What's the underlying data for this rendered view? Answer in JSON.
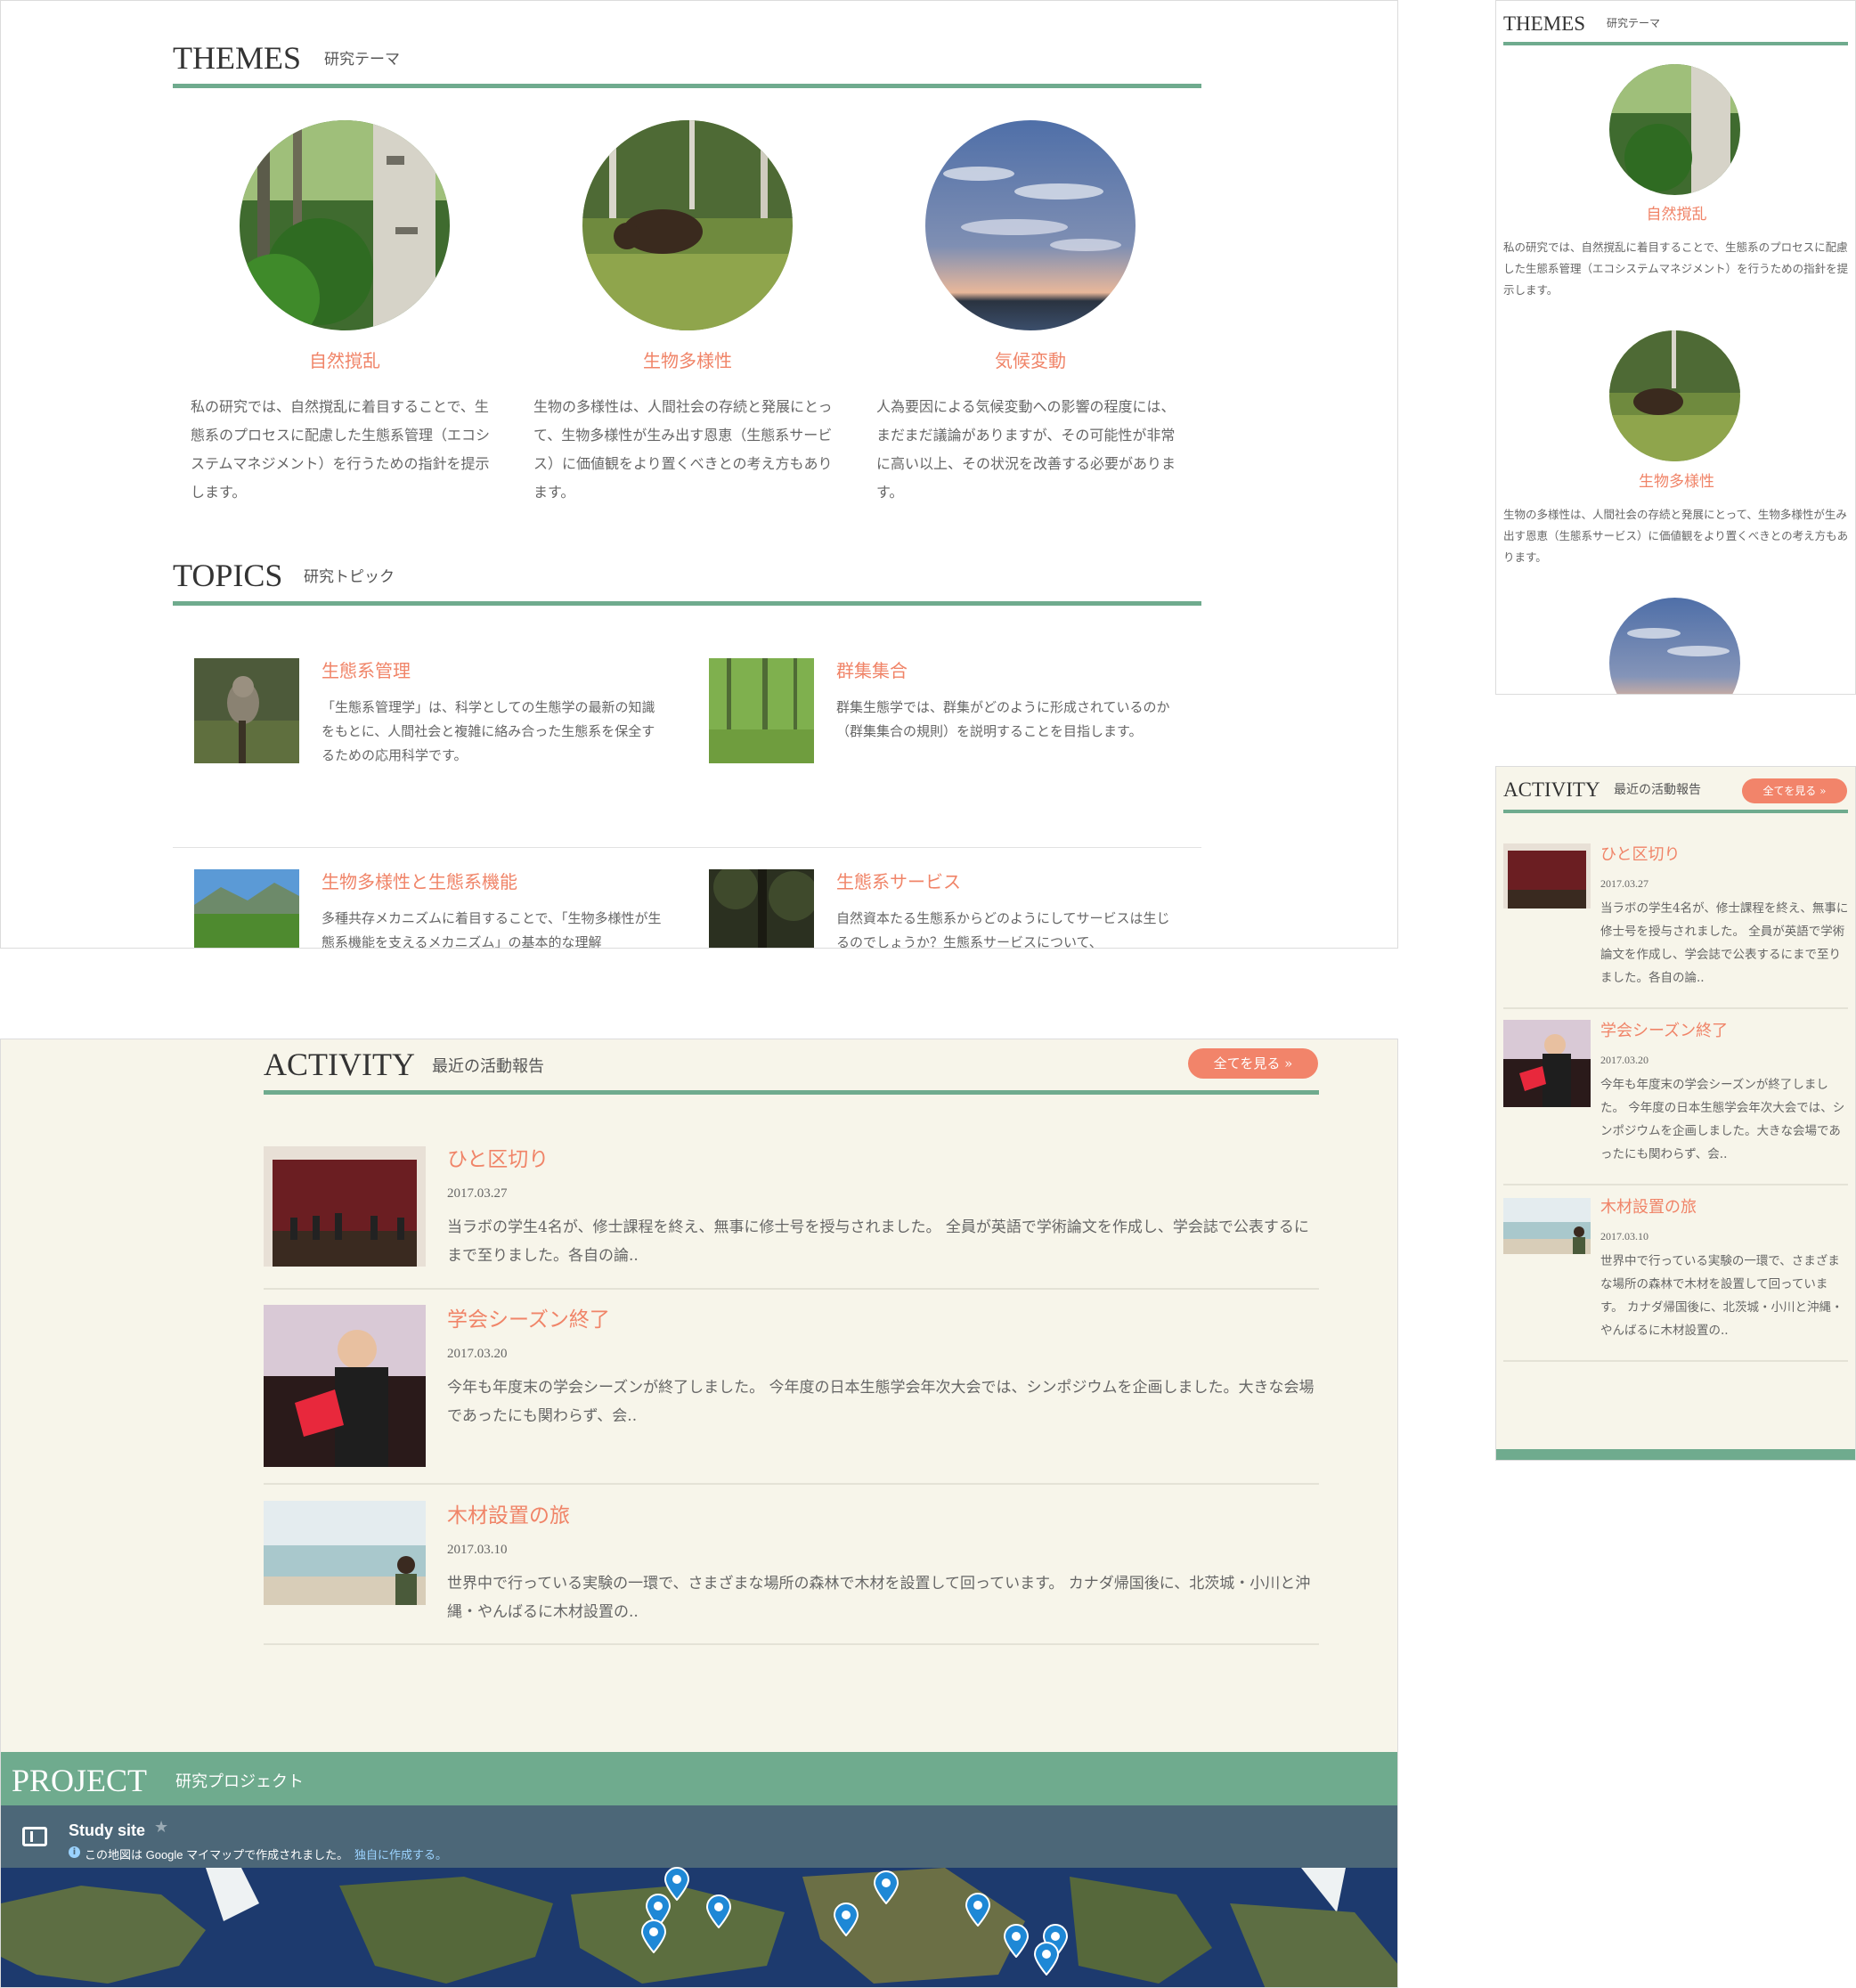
{
  "desktop_top": {
    "themes": {
      "title": "THEMES",
      "subtitle": "研究テーマ",
      "items": [
        {
          "image": "forest-photo",
          "title": "自然撹乱",
          "text": "私の研究では、自然撹乱に着目することで、生態系のプロセスに配慮した生態系管理（エコシステムマネジメント）を行うための指針を提示します。"
        },
        {
          "image": "bear-photo",
          "title": "生物多様性",
          "text": "生物の多様性は、人間社会の存続と発展にとって、生物多様性が生み出す恩恵（生態系サービス）に価値観をより置くべきとの考え方もあります。"
        },
        {
          "image": "sunset-sky-photo",
          "title": "気候変動",
          "text": "人為要因による気候変動への影響の程度には、まだまだ議論がありますが、その可能性が非常に高い以上、その状況を改善する必要があります。"
        }
      ]
    },
    "topics": {
      "title": "TOPICS",
      "subtitle": "研究トピック",
      "items": [
        {
          "image": "owl-photo",
          "title": "生態系管理",
          "text": "「生態系管理学」は、科学としての生態学の最新の知識をもとに、人間社会と複雑に絡み合った生態系を保全するための応用科学です。"
        },
        {
          "image": "green-forest-photo",
          "title": "群集集合",
          "text": "群集生態学では、群集がどのように形成されているのか（群集集合の規則）を説明することを目指します。"
        },
        {
          "image": "mountain-field-photo",
          "title": "生物多様性と生態系機能",
          "text": "多種共存メカニズムに着目することで、「生物多様性が生態系機能を支えるメカニズム」の基本的な理解"
        },
        {
          "image": "tree-canopy-photo",
          "title": "生態系サービス",
          "text": "自然資本たる生態系からどのようにしてサービスは生じるのでしょうか？生態系サービスについて、"
        }
      ]
    }
  },
  "mobile_top": {
    "themes": {
      "title": "THEMES",
      "subtitle": "研究テーマ",
      "items": [
        {
          "title": "自然撹乱",
          "text": "私の研究では、自然撹乱に着目することで、生態系のプロセスに配慮した生態系管理（エコシステムマネジメント）を行うための指針を提示します。"
        },
        {
          "title": "生物多様性",
          "text": "生物の多様性は、人間社会の存続と発展にとって、生物多様性が生み出す恩恵（生態系サービス）に価値観をより置くべきとの考え方もあります。"
        }
      ]
    }
  },
  "desktop_bottom": {
    "activity": {
      "title": "ACTIVITY",
      "subtitle": "最近の活動報告",
      "see_all": "全てを見る »",
      "items": [
        {
          "image": "ceremony-stage-photo",
          "title": "ひと区切り",
          "date": "2017.03.27",
          "text": "当ラボの学生4名が、修士課程を終え、無事に修士号を授与されました。 全員が英語で学術論文を作成し、学会誌で公表するにまで至りました。各自の論.."
        },
        {
          "image": "award-presenter-photo",
          "title": "学会シーズン終了",
          "date": "2017.03.20",
          "text": "今年も年度末の学会シーズンが終了しました。 今年度の日本生態学会年次大会では、シンポジウムを企画しました。大きな会場であったにも関わらず、会.."
        },
        {
          "image": "beach-person-photo",
          "title": "木材設置の旅",
          "date": "2017.03.10",
          "text": "世界中で行っている実験の一環で、さまざまな場所の森林で木材を設置して回っています。 カナダ帰国後に、北茨城・小川と沖縄・やんばるに木材設置の.."
        }
      ]
    },
    "project": {
      "title": "PROJECT",
      "subtitle": "研究プロジェクト",
      "map_title": "Study site",
      "map_note": "この地図は Google マイマップで作成されました。",
      "map_link": "独自に作成する。"
    }
  },
  "mobile_bottom": {
    "activity": {
      "title": "ACTIVITY",
      "subtitle": "最近の活動報告",
      "see_all": "全てを見る »",
      "items": [
        {
          "title": "ひと区切り",
          "date": "2017.03.27",
          "text": "当ラボの学生4名が、修士課程を終え、無事に修士号を授与されました。 全員が英語で学術論文を作成し、学会誌で公表するにまで至りました。各自の論.."
        },
        {
          "title": "学会シーズン終了",
          "date": "2017.03.20",
          "text": "今年も年度末の学会シーズンが終了しました。 今年度の日本生態学会年次大会では、シンポジウムを企画しました。大きな会場であったにも関わらず、会.."
        },
        {
          "title": "木材設置の旅",
          "date": "2017.03.10",
          "text": "世界中で行っている実験の一環で、さまざまな場所の森林で木材を設置して回っています。 カナダ帰国後に、北茨城・小川と沖縄・やんばるに木材設置の.."
        }
      ]
    }
  },
  "colors": {
    "accent_green": "#6fab8e",
    "accent_orange": "#f08468",
    "cream": "#f7f5ea",
    "map_header": "#4c6778",
    "pin_blue": "#1e88d6"
  }
}
